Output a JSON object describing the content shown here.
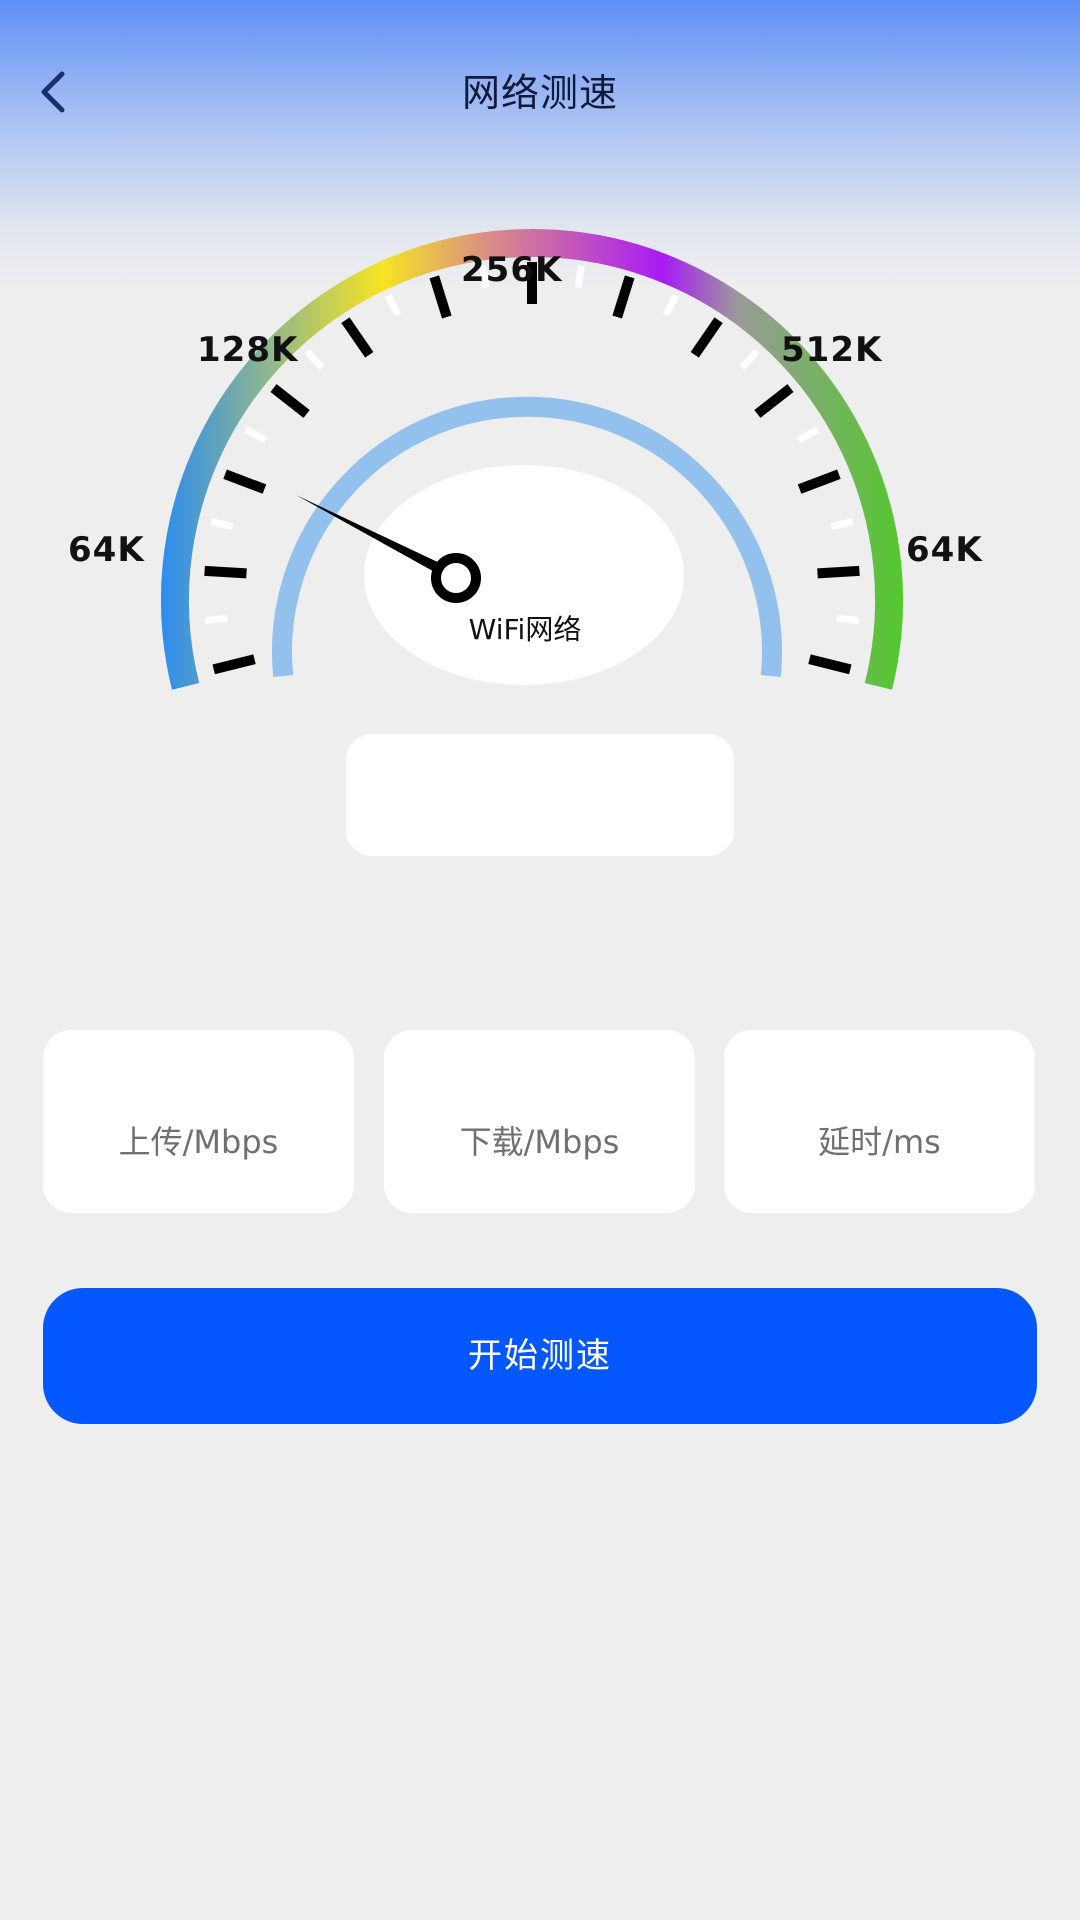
{
  "header": {
    "title": "网络测速",
    "back_icon": "chevron-left-icon"
  },
  "gauge": {
    "labels": [
      "64K",
      "128K",
      "256K",
      "512K",
      "64K"
    ],
    "center_label": "WiFi网络",
    "speed_value": "",
    "colors": {
      "arc_start": "#2d8cf0",
      "arc_yellow": "#f6e423",
      "arc_pink": "#d98a8a",
      "arc_purple": "#a81bf4",
      "arc_end": "#55c730",
      "inner_arc": "#93c1ee",
      "needle": "#000000"
    }
  },
  "stats": [
    {
      "label": "上传/Mbps",
      "value": ""
    },
    {
      "label": "下载/Mbps",
      "value": ""
    },
    {
      "label": "延时/ms",
      "value": ""
    }
  ],
  "actions": {
    "start_label": "开始测速",
    "start_color": "#0557ff"
  }
}
